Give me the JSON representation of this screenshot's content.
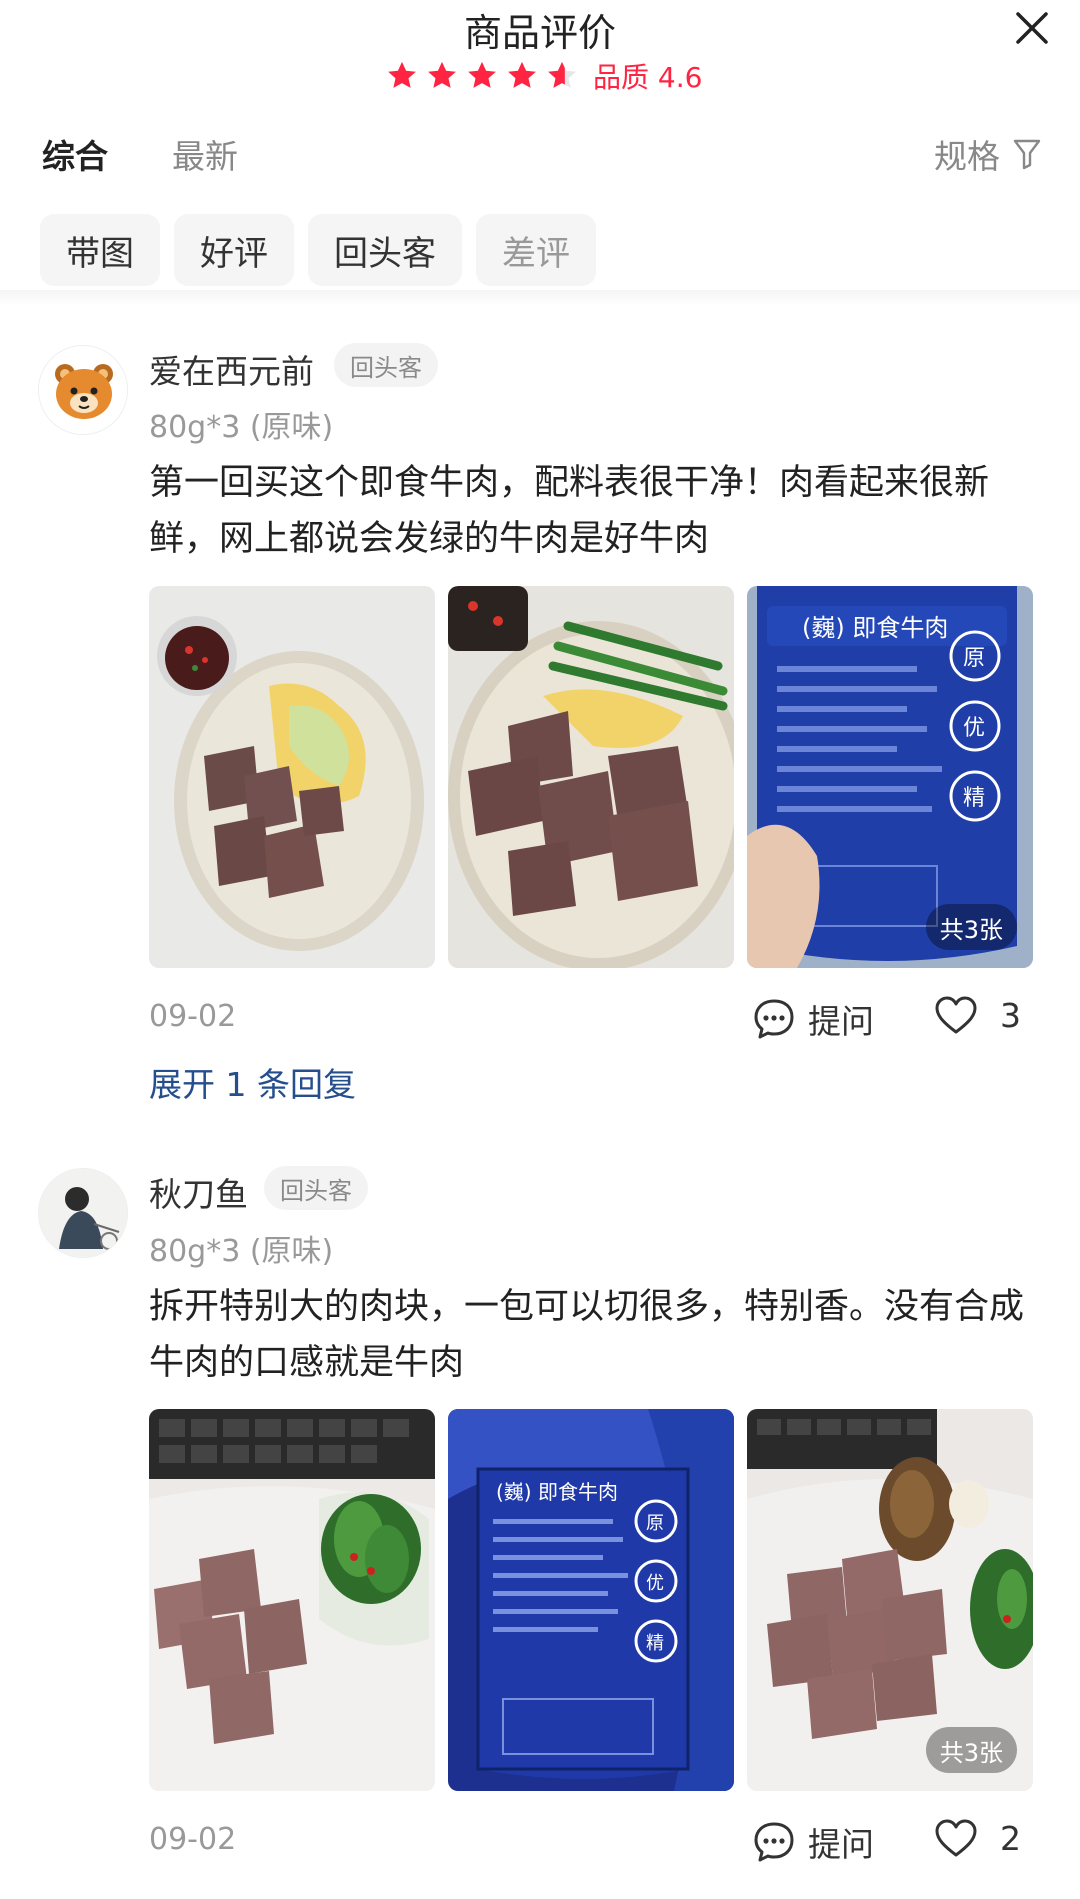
{
  "header": {
    "title": "商品评价",
    "rating_stars": 4.6,
    "quality_label": "品质 4.6",
    "accent_color": "#ff2442"
  },
  "tabs": {
    "overall": "综合",
    "latest": "最新",
    "spec": "规格"
  },
  "chips": [
    "带图",
    "好评",
    "回头客",
    "差评"
  ],
  "reviews": [
    {
      "username": "爱在西元前",
      "badge": "回头客",
      "spec": "80g*3 (原味)",
      "content": "第一回买这个即食牛肉，配料表很干净！肉看起来很新鲜，网上都说会发绿的牛肉是好牛肉",
      "photo_count": "共3张",
      "date": "09-02",
      "ask_label": "提问",
      "likes": "3",
      "expand": "展开 1 条回复"
    },
    {
      "username": "秋刀鱼",
      "badge": "回头客",
      "spec": "80g*3 (原味)",
      "content": "拆开特别大的肉块，一包可以切很多，特别香。没有合成牛肉的口感就是牛肉",
      "photo_count": "共3张",
      "date": "09-02",
      "ask_label": "提问",
      "likes": "2"
    }
  ]
}
